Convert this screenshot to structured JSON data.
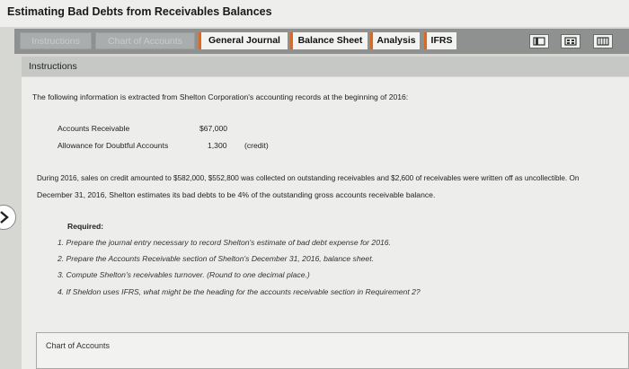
{
  "window": {
    "title": "Estimating Bad Debts from Receivables Balances"
  },
  "tabs": [
    {
      "label": "Instructions",
      "active": false
    },
    {
      "label": "Chart of Accounts",
      "active": false
    },
    {
      "label": "General Journal",
      "active": true
    },
    {
      "label": "Balance Sheet",
      "active": true
    },
    {
      "label": "Analysis",
      "active": true
    },
    {
      "label": "IFRS",
      "active": true
    }
  ],
  "toolbar": {
    "icons": [
      "bookmark-icon",
      "calculator-icon",
      "grid-icon"
    ]
  },
  "panel": {
    "heading": "Instructions",
    "intro": "The following information is extracted from Shelton Corporation's accounting records at the beginning of 2016:",
    "accounts": [
      {
        "name": "Accounts Receivable",
        "amount": "$67,000",
        "note": ""
      },
      {
        "name": "Allowance for Doubtful Accounts",
        "amount": "1,300",
        "note": "(credit)"
      }
    ],
    "paragraph_line1": "During 2016, sales on credit amounted to $582,000, $552,800 was collected on outstanding receivables and $2,600 of receivables were written off as uncollectible. On",
    "paragraph_line2": "December 31, 2016, Shelton estimates its bad debts to be 4% of the outstanding gross accounts receivable balance.",
    "required_heading": "Required:",
    "requirements": [
      "1.  Prepare the journal entry necessary to record Shelton's estimate of bad debt expense for 2016.",
      "2.  Prepare the Accounts Receivable section of Shelton's December 31, 2016, balance sheet.",
      "3.  Compute Shelton's receivables turnover. (Round to one decimal place.)",
      "4.  If Sheldon uses IFRS, what might be the heading for the accounts receivable section in Requirement 2?"
    ],
    "footer_label": "Chart of Accounts"
  }
}
